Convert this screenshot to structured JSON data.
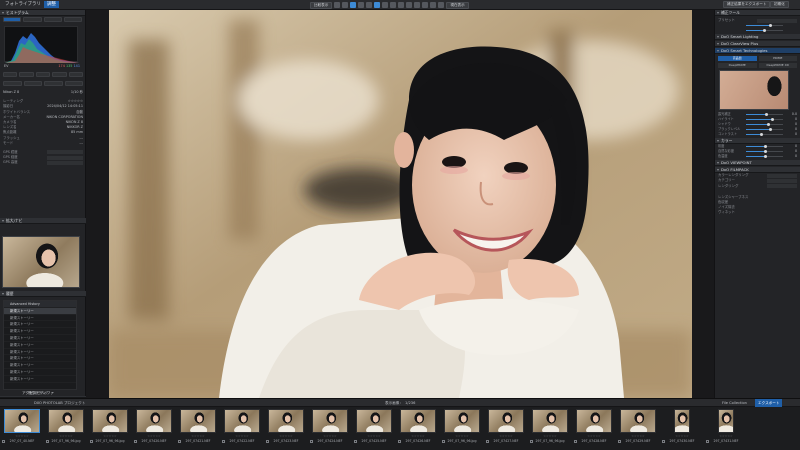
{
  "topbar": {
    "tabs": [
      "フォトライブラリ",
      "調整"
    ],
    "center_buttons": [
      "比較表示",
      "現在表示"
    ],
    "right_button": "補正結果をエクスポート",
    "right_label": "初期化"
  },
  "left": {
    "histogram_title": "ヒストグラム",
    "histogram_tabs": [
      "RGB",
      "R",
      "G",
      "B"
    ],
    "histogram_values": [
      "174",
      "135",
      "141"
    ],
    "ev_label": "EV",
    "info_title": "情報",
    "file_name": "Nikon Z 8",
    "file_size": "1/10 秒",
    "info_rows": [
      {
        "k": "レーティング",
        "v": "☆☆☆☆☆"
      },
      {
        "k": "撮影日",
        "v": "2024/04/12 14:05:11"
      },
      {
        "k": "ホワイトバランス",
        "v": "自動"
      },
      {
        "k": "メーカー名",
        "v": "NIKON CORPORATION"
      },
      {
        "k": "カメラ名",
        "v": "NIKON Z 8"
      },
      {
        "k": "レンズ名",
        "v": "NIKKOR Z"
      },
      {
        "k": "焦点距離",
        "v": "85 mm"
      },
      {
        "k": "フラッシュ",
        "v": "---"
      },
      {
        "k": "モード",
        "v": "---"
      },
      {
        "k": "GPS 緯度",
        "v": ""
      },
      {
        "k": "GPS 経度",
        "v": ""
      },
      {
        "k": "GPS 高度",
        "v": ""
      }
    ],
    "nav_title": "拡大/ナビ",
    "history_title": "履歴",
    "history_header": "Advanced History",
    "history_items": [
      "新規ストーリー",
      "新規ストーリー",
      "新規ストーリー",
      "新規ストーリー",
      "新規ストーリー",
      "新規ストーリー",
      "新規ストーリー",
      "新規ストーリー",
      "新規ストーリー",
      "新規ストーリー",
      "新規ストーリー"
    ],
    "history_clear": "履歴をクリア",
    "bottom_label": "アクセスモディファ"
  },
  "right": {
    "header": "補正ツール",
    "preset_label": "プリセット",
    "sec1": "DxO Smart Lighting",
    "sec2": "DxO ClearView Plus",
    "sec3": "DxO Smart Technologies",
    "tabs": [
      "高品質",
      "PRIME",
      "DeepPRIME",
      "DeepPRIME XD"
    ],
    "sliders": [
      {
        "label": "露光補正",
        "val": "0.0",
        "pct": 55
      },
      {
        "label": "ハイライト",
        "val": "0",
        "pct": 70
      },
      {
        "label": "シャドウ",
        "val": "0",
        "pct": 60
      },
      {
        "label": "ブラックレベル",
        "val": "0",
        "pct": 65
      },
      {
        "label": "コントラスト",
        "val": "0",
        "pct": 40
      }
    ],
    "sec4": "カラー",
    "sliders2": [
      {
        "label": "彩度",
        "val": "0",
        "pct": 50
      },
      {
        "label": "自然な彩度",
        "val": "0",
        "pct": 50
      },
      {
        "label": "色温度",
        "val": "0",
        "pct": 50
      }
    ],
    "sec5": "DxO VIEWPOINT",
    "sec6": "DxO FILMPACK",
    "filmpack_rows": [
      "カラーレンダリング",
      "カテゴリー",
      "レンダリング"
    ],
    "bottom_rows": [
      "レンズシャープネス",
      "色収差",
      "ノイズ除去",
      "ヴィネット"
    ]
  },
  "film": {
    "left_label": "DXO PHOTOLAB プロジェクト",
    "center_label": "表示画像：",
    "count": "1/236",
    "right_tabs": [
      "File Collection",
      "エクスポート"
    ],
    "thumbs": [
      {
        "name": "297_07_40.NEF",
        "sel": true
      },
      {
        "name": "297_07_96_96.jpg",
        "sel": false
      },
      {
        "name": "297_07_96_96.jpg",
        "sel": false
      },
      {
        "name": "297_07420.NEF",
        "sel": false
      },
      {
        "name": "297_07421.NEF",
        "sel": false
      },
      {
        "name": "297_07422.NEF",
        "sel": false
      },
      {
        "name": "297_07423.NEF",
        "sel": false
      },
      {
        "name": "297_07424.NEF",
        "sel": false
      },
      {
        "name": "297_07425.NEF",
        "sel": false
      },
      {
        "name": "297_07426.NEF",
        "sel": false
      },
      {
        "name": "297_07_96_96.jpg",
        "sel": false
      },
      {
        "name": "297_07427.NEF",
        "sel": false
      },
      {
        "name": "297_07_96_96.jpg",
        "sel": false
      },
      {
        "name": "297_07428.NEF",
        "sel": false
      },
      {
        "name": "297_07429.NEF",
        "sel": false
      },
      {
        "name": "297_07430.NEF",
        "sel": false
      },
      {
        "name": "297_07431.NEF",
        "sel": false
      }
    ],
    "star_text": "☆☆☆☆☆"
  },
  "colors": {
    "accent": "#1f5fa8",
    "highlight": "#3d8bd6"
  }
}
